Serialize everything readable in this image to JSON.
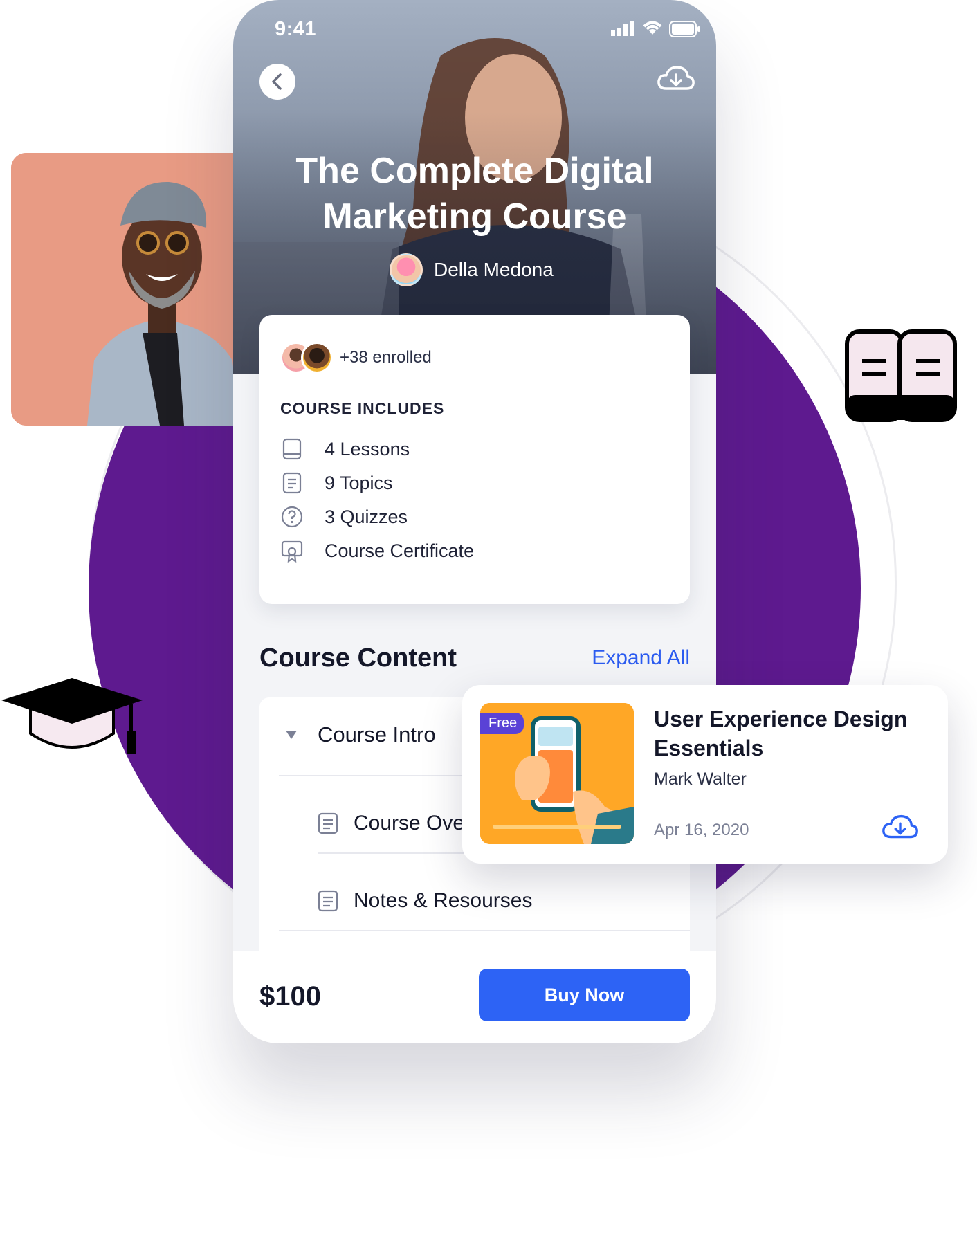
{
  "status_bar": {
    "time": "9:41"
  },
  "hero": {
    "title_line1": "The Complete Digital",
    "title_line2": "Marketing Course",
    "author": "Della Medona"
  },
  "includes": {
    "enrolled": "+38 enrolled",
    "heading": "COURSE INCLUDES",
    "items": [
      {
        "icon": "book-icon",
        "label": "4 Lessons"
      },
      {
        "icon": "document-icon",
        "label": "9 Topics"
      },
      {
        "icon": "question-icon",
        "label": "3 Quizzes"
      },
      {
        "icon": "certificate-icon",
        "label": "Course Certificate"
      }
    ]
  },
  "content": {
    "heading": "Course Content",
    "expand_label": "Expand All",
    "section_title": "Course Intro",
    "lessons": [
      "Course Overview",
      "Notes & Resourses"
    ]
  },
  "purchase": {
    "price": "$100",
    "buy_label": "Buy Now"
  },
  "featured": {
    "badge": "Free",
    "title": "User Experience Design Essentials",
    "author": "Mark Walter",
    "date": "Apr 16, 2020"
  },
  "colors": {
    "accent": "#2d63f5",
    "purple": "#5e1a8f",
    "badge": "#5a42d6"
  }
}
